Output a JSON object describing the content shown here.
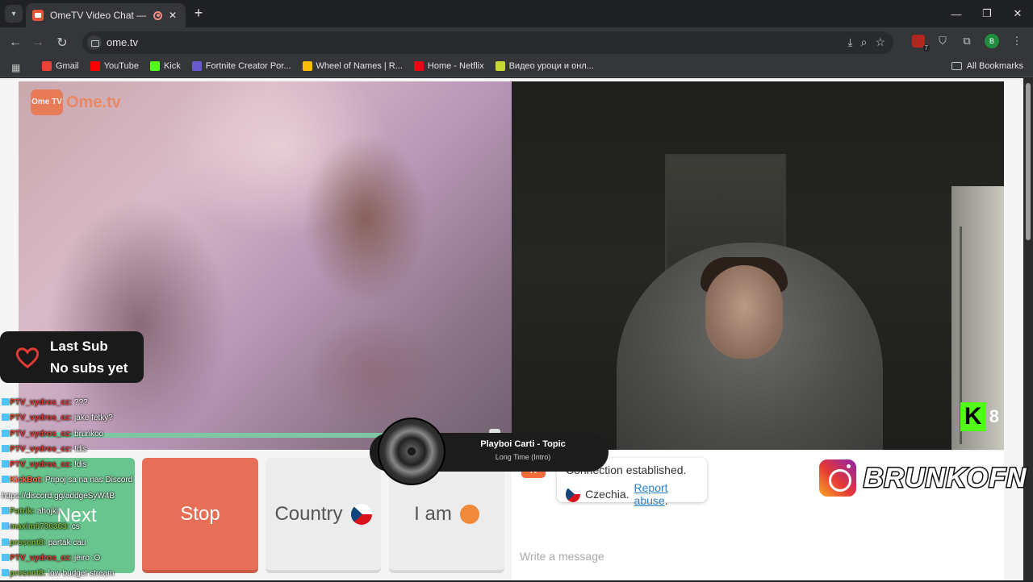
{
  "browser": {
    "tab_title": "OmeTV Video Chat — Ome",
    "url": "ome.tv",
    "bookmarks": [
      {
        "label": "Gmail",
        "color": "#ea4335"
      },
      {
        "label": "YouTube",
        "color": "#ff0000"
      },
      {
        "label": "Kick",
        "color": "#53fc18"
      },
      {
        "label": "Fortnite Creator Por...",
        "color": "#6a5acd"
      },
      {
        "label": "Wheel of Names | R...",
        "color": "#fbbc05"
      },
      {
        "label": "Home - Netflix",
        "color": "#e50914"
      },
      {
        "label": "Видео уроци и онл...",
        "color": "#c6d836"
      }
    ],
    "all_bookmarks": "All Bookmarks",
    "profile_initial": "B",
    "ext_badge": "7"
  },
  "logo": {
    "tv": "Ome TV",
    "text": "Ome.tv"
  },
  "stream": {
    "kick_viewers": "8",
    "last_sub_label": "Last Sub",
    "last_sub_value": "No subs yet",
    "progress": 1.0
  },
  "chat_overlay": [
    {
      "user": "PTV_vydros_cz:",
      "msg": "???",
      "color": "red"
    },
    {
      "user": "PTV_vydros_cz:",
      "msg": "jake fetky?",
      "color": "red"
    },
    {
      "user": "PTV_vydros_cz:",
      "msg": "brunkoo",
      "color": "red"
    },
    {
      "user": "PTV_vydros_cz:",
      "msg": "!dis",
      "color": "red"
    },
    {
      "user": "PTV_vydros_cz:",
      "msg": "!dis",
      "color": "red"
    },
    {
      "user": "KickBot:",
      "msg": "Pripoj sa na nas Discord",
      "color": "orange"
    },
    {
      "user": "",
      "msg": "https://discord.gg/addgeSyW4B",
      "color": "white"
    },
    {
      "user": "Patrik:",
      "msg": "ahojkii",
      "color": "green"
    },
    {
      "user": "maxim6736363:",
      "msg": "cs",
      "color": "green"
    },
    {
      "user": "present8:",
      "msg": "partak cau",
      "color": "green"
    },
    {
      "user": "PTV_vydros_cz:",
      "msg": "jeiro :O",
      "color": "red"
    },
    {
      "user": "present8:",
      "msg": "low budget stream",
      "color": "green"
    }
  ],
  "buttons": {
    "next": "Next",
    "stop": "Stop",
    "country": "Country",
    "gender": "I am"
  },
  "chat": {
    "connection": "Connection established.",
    "country": "Czechia.",
    "report": "Report abuse",
    "report_suffix": ".",
    "placeholder": "Write a message"
  },
  "now_playing": {
    "title": "Playboi Carti - Topic",
    "subtitle": "Long Time (Intro)"
  },
  "brand": {
    "name": "BRUNKOFN"
  }
}
